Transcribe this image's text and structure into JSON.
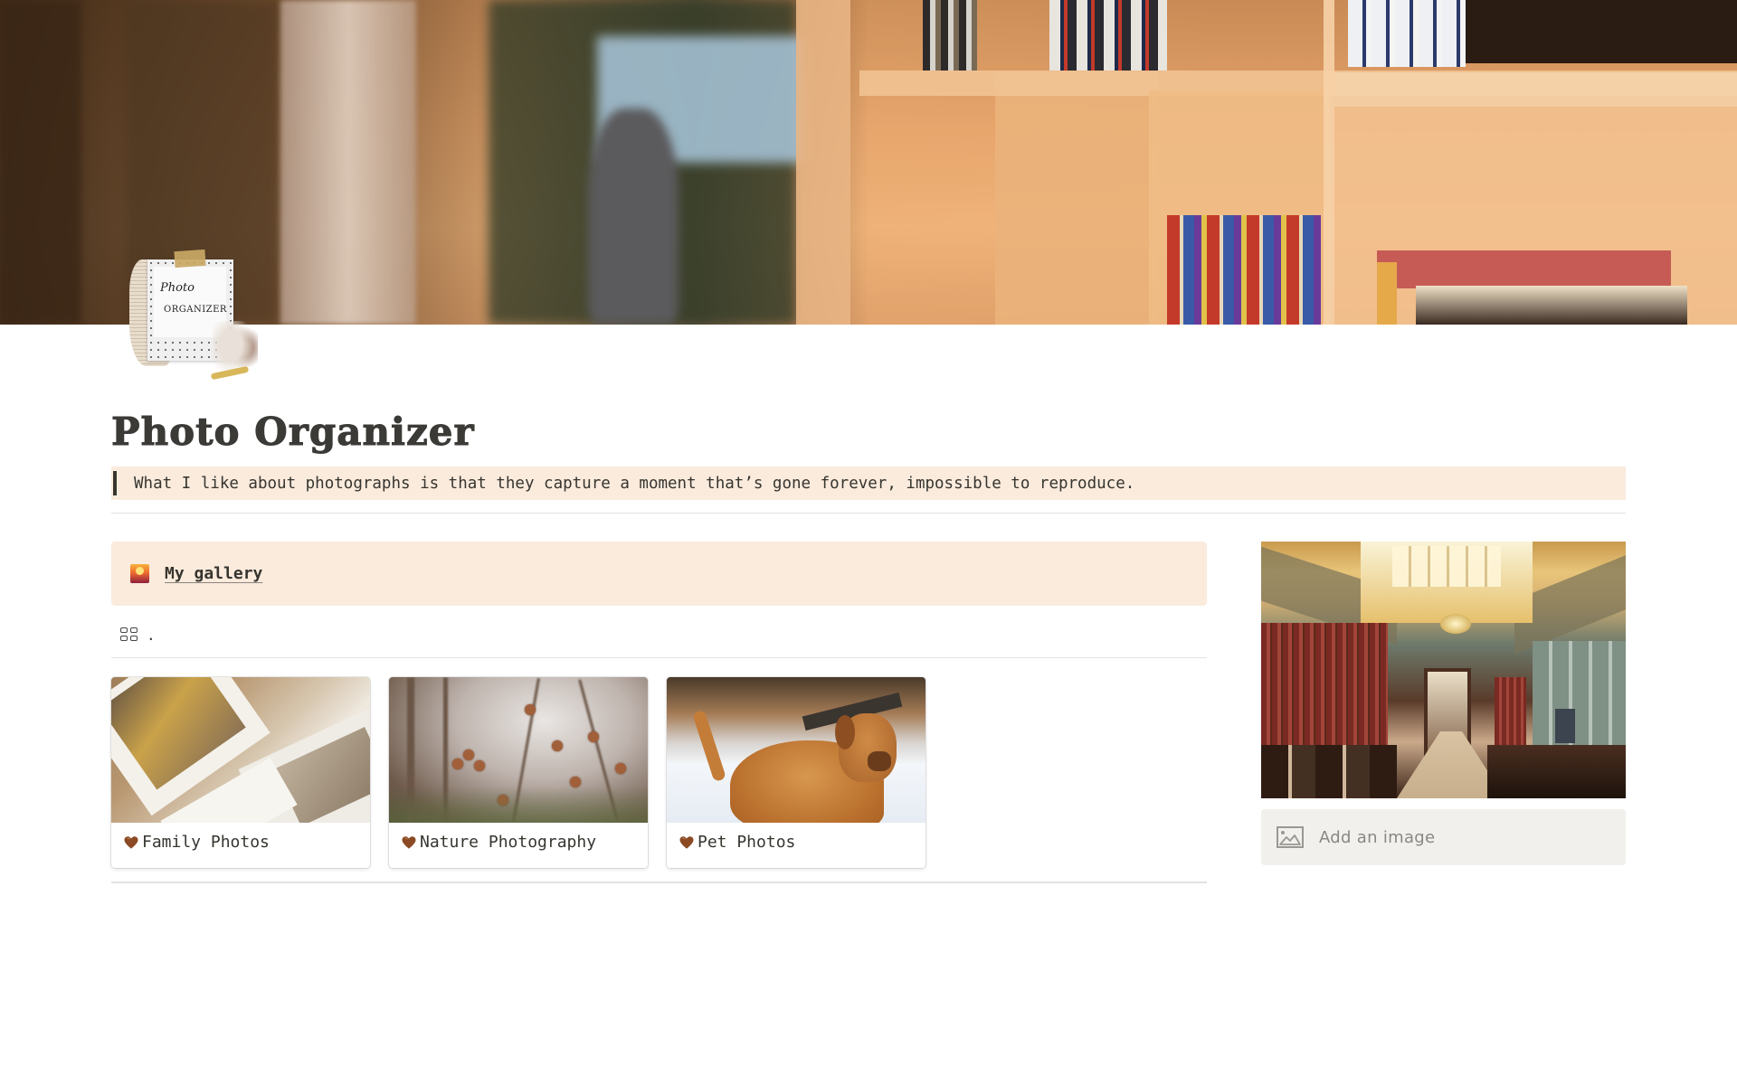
{
  "page": {
    "title": "Photo Organizer",
    "icon": "photo-organizer-polaroid-icon",
    "icon_text_line1": "Photo",
    "icon_text_line2": "ORGANIZER",
    "cover": "library-bookshelf-cover"
  },
  "quote": {
    "text": "What I like about photographs is that they capture a moment that’s gone forever, impossible to reproduce."
  },
  "callout": {
    "emoji": "city-sunset-emoji",
    "link_label": "My gallery",
    "background": "#FAEBDD"
  },
  "gallery": {
    "view_icon": "gallery-grid-icon",
    "view_name": ".",
    "cards": [
      {
        "label": "Family Photos",
        "icon": "brown-heart-icon",
        "image": "family-photos-thumbnail"
      },
      {
        "label": "Nature Photography",
        "icon": "brown-heart-icon",
        "image": "nature-photography-thumbnail"
      },
      {
        "label": "Pet Photos",
        "icon": "brown-heart-icon",
        "image": "pet-photos-thumbnail"
      }
    ]
  },
  "sidebar": {
    "image": "library-reading-room-image",
    "add_image_label": "Add an image",
    "add_image_icon": "image-placeholder-icon"
  },
  "colors": {
    "accent_bg": "#FAEBDD",
    "text": "#37352F",
    "heart": "#8B4A24",
    "add_image_bg": "#F1F0ED"
  }
}
